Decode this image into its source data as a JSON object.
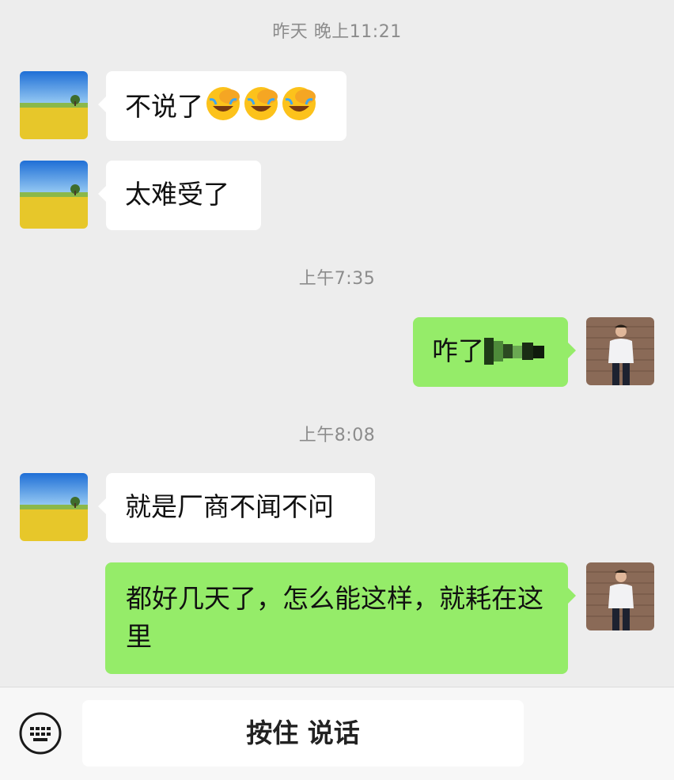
{
  "timestamps": {
    "t1": "昨天 晚上11:21",
    "t2": "上午7:35",
    "t3": "上午8:08"
  },
  "messages": [
    {
      "from": "contact",
      "text": "不说了",
      "emoji": [
        "face-palm-crying",
        "face-palm-crying",
        "face-palm-crying"
      ]
    },
    {
      "from": "contact",
      "text": "太难受了"
    },
    {
      "from": "me",
      "text": "咋了",
      "partially_obscured": true
    },
    {
      "from": "contact",
      "text": "就是厂商不闻不问"
    },
    {
      "from": "me",
      "text": "都好几天了，怎么能这样，就耗在这里"
    }
  ],
  "input_bar": {
    "mode_icon": "keyboard-icon",
    "hold_to_talk_label": "按住 说话"
  },
  "colors": {
    "background": "#ededed",
    "incoming_bubble": "#ffffff",
    "outgoing_bubble": "#95ec69",
    "timestamp_text": "#8c8c8c"
  }
}
